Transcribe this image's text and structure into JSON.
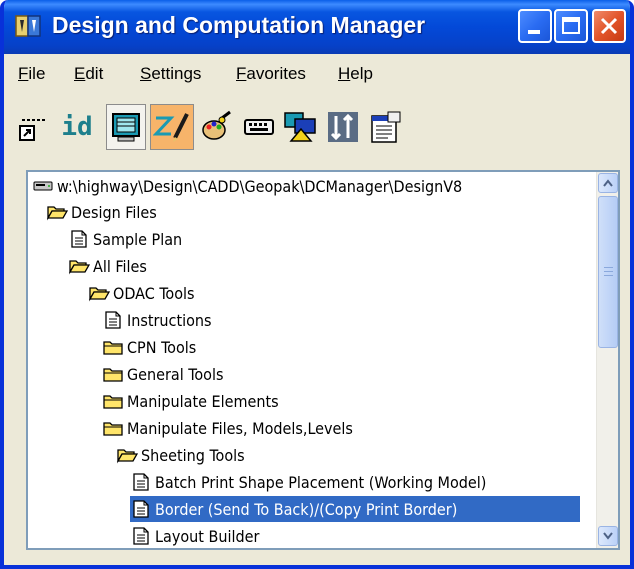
{
  "window": {
    "title": "Design and Computation Manager"
  },
  "menu": [
    {
      "label": "File",
      "underline": "F",
      "rest": "ile"
    },
    {
      "label": "Edit",
      "underline": "E",
      "rest": "dit"
    },
    {
      "label": "Settings",
      "underline": "S",
      "rest": "ettings"
    },
    {
      "label": "Favorites",
      "underline": "F",
      "rest": "avorites"
    },
    {
      "label": "Help",
      "underline": "H",
      "rest": "elp"
    }
  ],
  "toolbar": {
    "id_label": "id",
    "icons": [
      "shortcut-icon",
      "id-icon",
      "monitor-icon",
      "design-mode-icon",
      "palette-icon",
      "keyboard-icon",
      "shapes-icon",
      "sort-icon",
      "properties-icon"
    ]
  },
  "tree": {
    "items": [
      {
        "label": "w:\\highway\\Design\\CADD\\Geopak\\DCManager\\DesignV8",
        "icon": "drive",
        "selected": false
      },
      {
        "label": "Design Files",
        "icon": "folder-open",
        "selected": false
      },
      {
        "label": "Sample Plan",
        "icon": "document",
        "selected": false
      },
      {
        "label": "All Files",
        "icon": "folder-open",
        "selected": false
      },
      {
        "label": "ODAC Tools",
        "icon": "folder-open",
        "selected": false
      },
      {
        "label": "Instructions",
        "icon": "document",
        "selected": false
      },
      {
        "label": "CPN Tools",
        "icon": "folder",
        "selected": false
      },
      {
        "label": "General Tools",
        "icon": "folder",
        "selected": false
      },
      {
        "label": "Manipulate Elements",
        "icon": "folder",
        "selected": false
      },
      {
        "label": "Manipulate Files, Models,Levels",
        "icon": "folder",
        "selected": false
      },
      {
        "label": "Sheeting Tools",
        "icon": "folder-open",
        "selected": false
      },
      {
        "label": "Batch Print Shape Placement (Working Model)",
        "icon": "document",
        "selected": false
      },
      {
        "label": "Border (Send To Back)/(Copy Print Border)",
        "icon": "document",
        "selected": true
      },
      {
        "label": "Layout Builder",
        "icon": "document",
        "selected": false
      }
    ]
  },
  "colors": {
    "selection": "#316ac5",
    "titlebar": "#0349d8",
    "close": "#e2552a",
    "active_tool": "#f7b46a"
  }
}
